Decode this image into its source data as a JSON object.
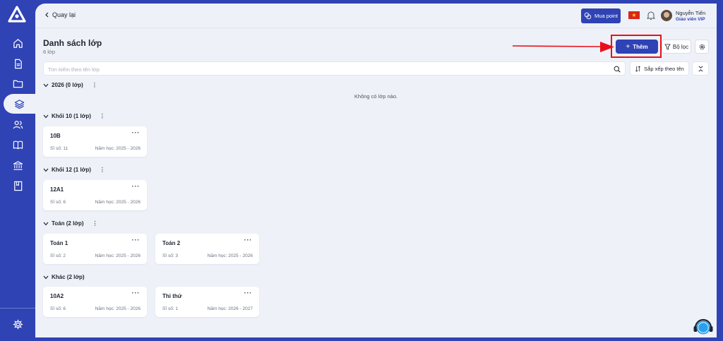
{
  "topbar": {
    "back_label": "Quay lại",
    "buy_label": "Mua point",
    "user_name": "Nguyễn Tiến",
    "user_role": "Giáo viên VIP"
  },
  "page": {
    "title": "Danh sách lớp",
    "count": "6 lớp",
    "add_label": "Thêm",
    "filter_label": "Bộ lọc",
    "search_placeholder": "Tìm kiếm theo tên lớp",
    "sort_label": "Sắp xếp theo tên",
    "empty_text": "Không có lớp nào."
  },
  "groups": [
    {
      "label": "2026 (0 lớp)",
      "classes": []
    },
    {
      "label": "Khối 10 (1 lớp)",
      "classes": [
        {
          "name": "10B",
          "size": "Sĩ số: 11",
          "year": "Năm học: 2025 - 2026"
        }
      ]
    },
    {
      "label": "Khối 12 (1 lớp)",
      "classes": [
        {
          "name": "12A1",
          "size": "Sĩ số: 6",
          "year": "Năm học: 2025 - 2026"
        }
      ]
    },
    {
      "label": "Toán (2 lớp)",
      "classes": [
        {
          "name": "Toán 1",
          "size": "Sĩ số: 2",
          "year": "Năm học: 2025 - 2026"
        },
        {
          "name": "Toán 2",
          "size": "Sĩ số: 3",
          "year": "Năm học: 2025 - 2026"
        }
      ]
    },
    {
      "label": "Khác (2 lớp)",
      "classes": [
        {
          "name": "10A2",
          "size": "Sĩ số: 6",
          "year": "Năm học: 2025 - 2026"
        },
        {
          "name": "Thi thử",
          "size": "Sĩ số: 1",
          "year": "Năm học: 2026 - 2027"
        }
      ]
    }
  ],
  "sidebar": {
    "items": [
      "home-icon",
      "document-icon",
      "folder-icon",
      "layers-icon",
      "users-icon",
      "book-icon",
      "bank-icon",
      "notebook-icon"
    ],
    "active_index": 3,
    "bottom": "settings-icon"
  },
  "colors": {
    "brand": "#2f43b5",
    "background": "#eef1f8",
    "highlight": "#e8101b"
  }
}
